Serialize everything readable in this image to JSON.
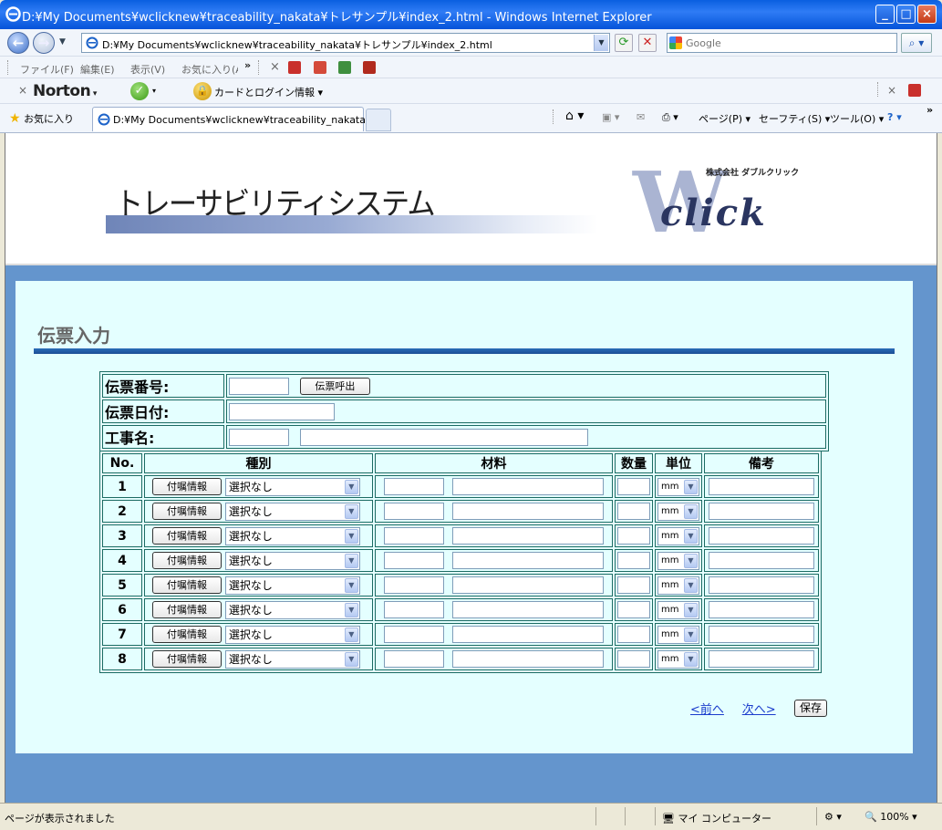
{
  "window": {
    "title": "D:¥My Documents¥wclicknew¥traceability_nakata¥トレサンプル¥index_2.html - Windows Internet Explorer",
    "minimize": "_",
    "maximize": "□",
    "close": "×"
  },
  "address": {
    "url": "D:¥My Documents¥wclicknew¥traceability_nakata¥トレサンプル¥index_2.html",
    "search_placeholder": "Google"
  },
  "menu": {
    "items": [
      "ファイル(F)",
      "編集(E)",
      "表示(V)",
      "お気に入り(A"
    ],
    "more": "»"
  },
  "norton": {
    "brand": "Norton",
    "card_label": "カードとログイン情報"
  },
  "tabs": {
    "favorites": "お気に入り",
    "active_tab": "D:¥My Documents¥wclicknew¥traceability_nakata¥...",
    "page_cmd": "ページ(P)",
    "safety_cmd": "セーフティ(S)",
    "tools_cmd": "ツール(O)"
  },
  "header": {
    "system_name": "トレーサビリティシステム",
    "company": "株式会社 ダブルクリック",
    "logo_w": "W",
    "logo_text": "click"
  },
  "form": {
    "page_title": "伝票入力",
    "slip_no_label": "伝票番号:",
    "slip_call_button": "伝票呼出",
    "slip_date_label": "伝票日付:",
    "project_label": "工事名:",
    "columns": {
      "no": "No.",
      "kind": "種別",
      "material": "材料",
      "qty": "数量",
      "unit": "単位",
      "remarks": "備考"
    },
    "attach_button": "付嘱情報",
    "select_default": "選択なし",
    "unit_default": "mm",
    "rows": [
      "1",
      "2",
      "3",
      "4",
      "5",
      "6",
      "7",
      "8"
    ],
    "prev_link": "<前へ",
    "next_link": "次へ>",
    "save_button": "保存"
  },
  "status": {
    "message": "ページが表示されました",
    "zone": "マイ コンピューター",
    "zoom": "100%"
  }
}
